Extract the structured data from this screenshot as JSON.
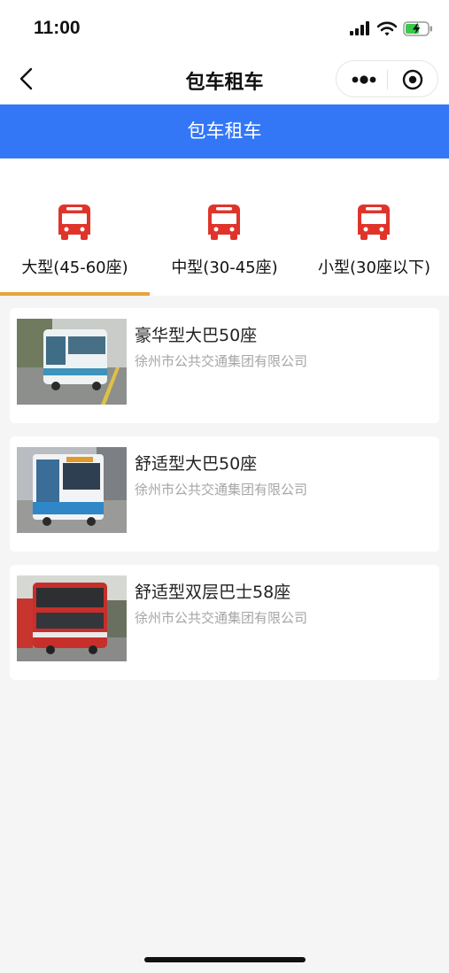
{
  "status_bar": {
    "time": "11:00"
  },
  "nav": {
    "title": "包车租车"
  },
  "banner": {
    "title": "包车租车"
  },
  "tabs": [
    {
      "label": "大型(45-60座)",
      "active": true
    },
    {
      "label": "中型(30-45座)",
      "active": false
    },
    {
      "label": "小型(30座以下)",
      "active": false
    }
  ],
  "vehicles": [
    {
      "title": "豪华型大巴50座",
      "company": "徐州市公共交通集团有限公司"
    },
    {
      "title": "舒适型大巴50座",
      "company": "徐州市公共交通集团有限公司"
    },
    {
      "title": "舒适型双层巴士58座",
      "company": "徐州市公共交通集团有限公司"
    }
  ],
  "colors": {
    "banner": "#3377f7",
    "bus_icon": "#e0342b",
    "tab_indicator": "#e8a33c"
  }
}
